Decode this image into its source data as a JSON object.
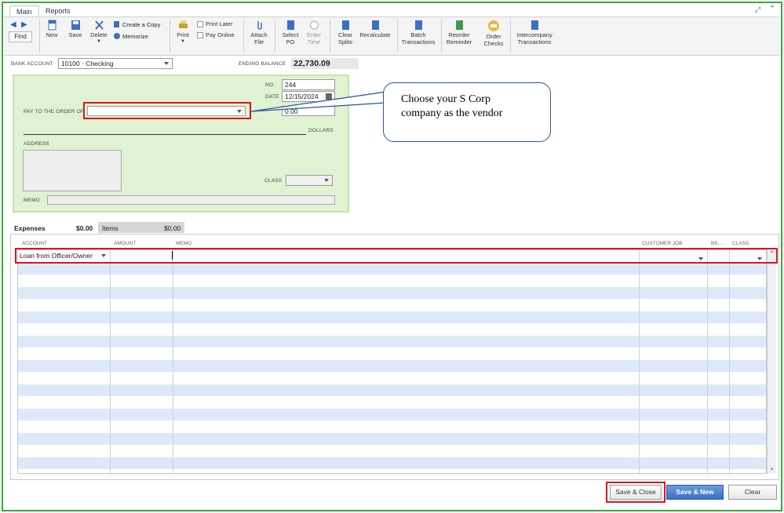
{
  "tabs": [
    "Main",
    "Reports"
  ],
  "toolbar": {
    "find": "Find",
    "new": "New",
    "save": "Save",
    "delete": "Delete",
    "create_copy": "Create a Copy",
    "memorize": "Memorize",
    "print": "Print",
    "print_later": "Print Later",
    "pay_online": "Pay Online",
    "attach_file": [
      "Attach",
      "File"
    ],
    "select_po": [
      "Select",
      "PO"
    ],
    "enter_time": [
      "Enter",
      "Time"
    ],
    "clear_splits": [
      "Clear",
      "Splits"
    ],
    "recalculate": "Recalculate",
    "batch_transactions": [
      "Batch",
      "Transactions"
    ],
    "reorder_reminder": [
      "Reorder",
      "Reminder"
    ],
    "order_checks": [
      "Order",
      "Checks"
    ],
    "intercompany_transactions": [
      "Intercompany",
      "Transactions"
    ]
  },
  "header": {
    "bank_account_label": "BANK ACCOUNT",
    "bank_account_value": "10100 · Checking",
    "ending_balance_label": "ENDING BALANCE",
    "ending_balance_value": "22,730.09"
  },
  "check": {
    "no_label": "NO.",
    "no_value": "244",
    "date_label": "DATE",
    "date_value": "12/15/2024",
    "pay_to_label": "PAY TO THE ORDER OF",
    "pay_to_value": "",
    "amount_value": "0.00",
    "dollars_label": "DOLLARS",
    "address_label": "ADDRESS",
    "class_label": "CLASS",
    "memo_label": "MEMO"
  },
  "callout": {
    "line1": "Choose your S Corp",
    "line2": "company as the vendor"
  },
  "splits": {
    "expenses_label": "Expenses",
    "expenses_total": "$0.00",
    "items_label": "Items",
    "items_total": "$0.00",
    "columns": [
      "ACCOUNT",
      "AMOUNT",
      "MEMO",
      "CUSTOMER:JOB",
      "BIL...",
      "CLASS"
    ],
    "first_row_account": "Loan from Officer/Owner"
  },
  "footer": {
    "save_close": "Save & Close",
    "save_new": "Save & New",
    "clear": "Clear"
  },
  "colors": {
    "frame_green": "#3aa83a",
    "check_green": "#dff3d3",
    "highlight_red": "#e0141e",
    "callout_blue": "#2f5597",
    "row_blue": "#dde9f8",
    "primary_blue": "#3a6fc4"
  }
}
